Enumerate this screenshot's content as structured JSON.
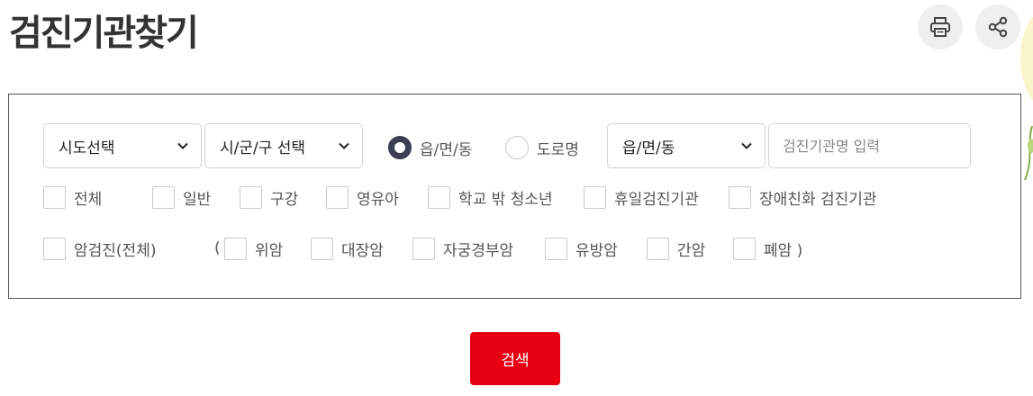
{
  "header": {
    "title": "검진기관찾기",
    "print_icon": "printer-icon",
    "share_icon": "share-icon"
  },
  "filters": {
    "sido_select": {
      "value": "시도선택"
    },
    "sigungu_select": {
      "value": "시/군/구 선택"
    },
    "address_type": {
      "options": [
        {
          "label": "읍/면/동",
          "selected": true
        },
        {
          "label": "도로명",
          "selected": false
        }
      ]
    },
    "dong_select": {
      "value": "읍/면/동"
    },
    "name_input": {
      "placeholder": "검진기관명 입력",
      "value": ""
    }
  },
  "categories_row1": [
    {
      "label": "전체",
      "checked": false
    },
    {
      "label": "일반",
      "checked": false
    },
    {
      "label": "구강",
      "checked": false
    },
    {
      "label": "영유아",
      "checked": false
    },
    {
      "label": "학교 밖 청소년",
      "checked": false
    },
    {
      "label": "휴일검진기관",
      "checked": false
    },
    {
      "label": "장애친화 검진기관",
      "checked": false
    }
  ],
  "categories_row2": {
    "all": {
      "label": "암검진(전체)",
      "checked": false
    },
    "open_paren": "(",
    "items": [
      {
        "label": "위암",
        "checked": false
      },
      {
        "label": "대장암",
        "checked": false
      },
      {
        "label": "자궁경부암",
        "checked": false
      },
      {
        "label": "유방암",
        "checked": false
      },
      {
        "label": "간암",
        "checked": false
      },
      {
        "label": "폐암 )",
        "checked": false
      }
    ]
  },
  "search_button": {
    "label": "검색"
  },
  "colors": {
    "accent": "#e60012",
    "radio_selected": "#3c3f52",
    "border": "#555555",
    "title": "#333333"
  }
}
